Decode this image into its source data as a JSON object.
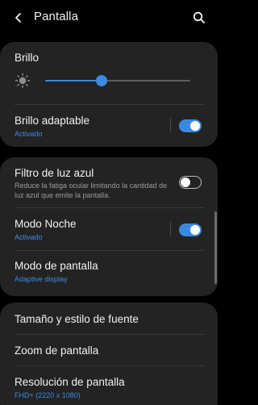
{
  "header": {
    "title": "Pantalla",
    "back_icon": "back-arrow-icon",
    "search_icon": "search-icon"
  },
  "brightness": {
    "label": "Brillo",
    "level": 0.39,
    "icon": "sun-icon"
  },
  "adaptive_brightness": {
    "label": "Brillo adaptable",
    "status": "Activado",
    "enabled": true
  },
  "blue_light_filter": {
    "label": "Filtro de luz azul",
    "description": "Reduce la fatiga ocular limitando la cantidad de luz azul que emite la pantalla.",
    "enabled": false
  },
  "night_mode": {
    "label": "Modo Noche",
    "status": "Activado",
    "enabled": true
  },
  "screen_mode": {
    "label": "Modo de pantalla",
    "value": "Adaptive display"
  },
  "font_size": {
    "label": "Tamaño y estilo de fuente"
  },
  "screen_zoom": {
    "label": "Zoom de pantalla"
  },
  "screen_resolution": {
    "label": "Resolución de pantalla",
    "value": "FHD+ (2220 x 1080)"
  },
  "colors": {
    "accent": "#3c8ae0",
    "card": "#232323",
    "background": "#000000"
  }
}
